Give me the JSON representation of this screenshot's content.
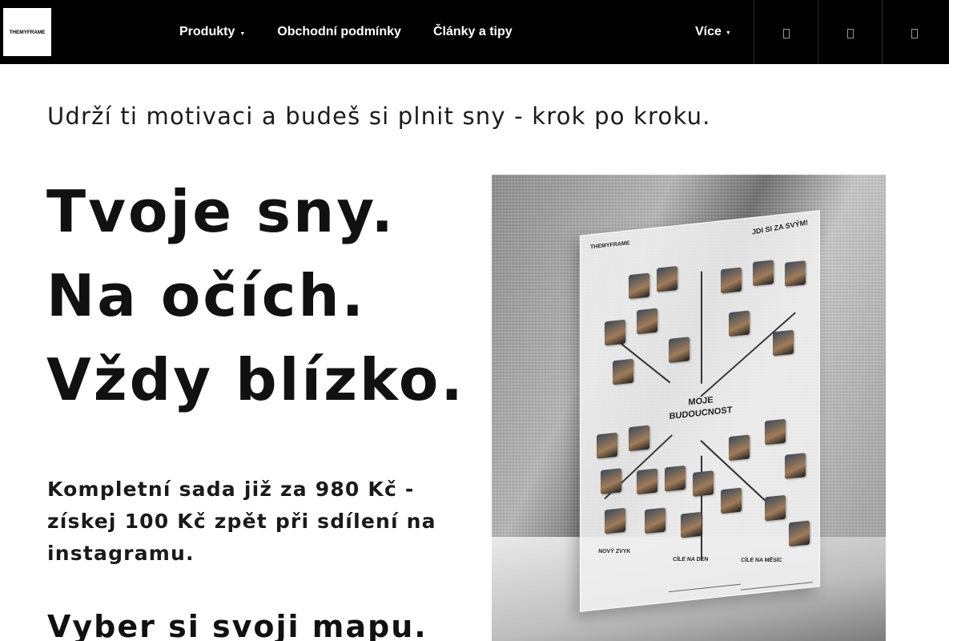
{
  "header": {
    "logo_text": "THEMYFRAME",
    "nav": [
      {
        "label": "Produkty",
        "has_dropdown": true
      },
      {
        "label": "Obchodní podmínky",
        "has_dropdown": false
      },
      {
        "label": "Články a tipy",
        "has_dropdown": false
      }
    ],
    "more_label": "Více",
    "icons": [
      "search-icon",
      "user-icon",
      "cart-icon"
    ]
  },
  "hero": {
    "tagline": "Udrží ti motivaci a budeš si plnit sny - krok po kroku.",
    "headline_1": "Tvoje sny.",
    "headline_2": "Na očích.",
    "headline_3": "Vždy blízko.",
    "offer": "Kompletní sada již za 980 Kč - získej 100 Kč zpět při sdílení na instagramu.",
    "cta": "Vyber si svoji mapu."
  },
  "product_image": {
    "brand": "THEMYFRAME",
    "slogan": "JDI SI ZA SVÝM!",
    "center_title": "MOJE BUDOUCNOST",
    "label_bottom_left": "NOVÝ ZVYK",
    "label_bottom_mid": "CÍLE NA DEN",
    "label_bottom_right": "CÍLE NA MĚSÍC"
  },
  "colors": {
    "header_bg": "#000000",
    "header_text": "#ffffff",
    "page_bg": "#ffffff",
    "hero_text": "#111111"
  }
}
